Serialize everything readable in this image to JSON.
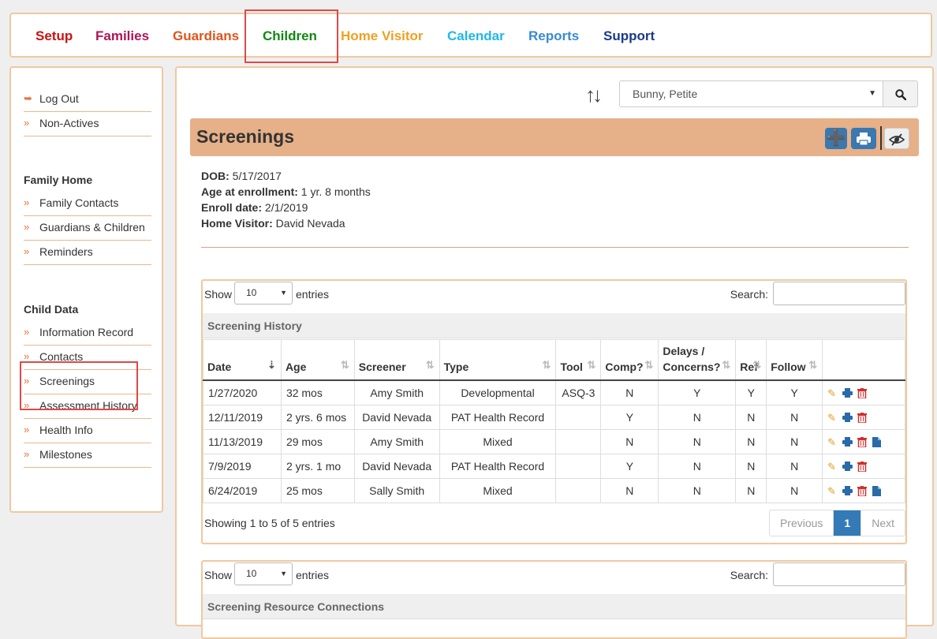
{
  "nav": {
    "items": [
      {
        "label": "Setup",
        "color": "#cc1111"
      },
      {
        "label": "Families",
        "color": "#b0145a"
      },
      {
        "label": "Guardians",
        "color": "#e0541c"
      },
      {
        "label": "Children",
        "color": "#118811"
      },
      {
        "label": "Home Visitor",
        "color": "#f0a020"
      },
      {
        "label": "Calendar",
        "color": "#20b8e8"
      },
      {
        "label": "Reports",
        "color": "#3a8ad0"
      },
      {
        "label": "Support",
        "color": "#1a3a8a"
      }
    ],
    "active": "Children"
  },
  "sidebar": {
    "top_items": [
      {
        "label": "Log Out",
        "icon": "logout-icon"
      },
      {
        "label": "Non-Actives",
        "icon": "chevron-icon"
      }
    ],
    "family_heading": "Family Home",
    "family_items": [
      "Family Contacts",
      "Guardians & Children",
      "Reminders"
    ],
    "child_heading": "Child Data",
    "child_items": [
      "Information Record",
      "Contacts",
      "Screenings",
      "Assessment History",
      "Health Info",
      "Milestones"
    ],
    "active": "Screenings"
  },
  "selector": {
    "value": "Bunny, Petite"
  },
  "page": {
    "title": "Screenings"
  },
  "child_info": {
    "dob_label": "DOB:",
    "dob": "5/17/2017",
    "age_label": "Age at enrollment:",
    "age": "1 yr. 8 months",
    "enroll_label": "Enroll date:",
    "enroll": "2/1/2019",
    "visitor_label": "Home Visitor:",
    "visitor": "David Nevada"
  },
  "history_table": {
    "show_label": "Show",
    "entries_label": "entries",
    "length_value": "10",
    "search_label": "Search:",
    "caption": "Screening History",
    "columns": [
      "Date",
      "Age",
      "Screener",
      "Type",
      "Tool",
      "Comp?",
      "Delays / Concerns?",
      "Ref",
      "Follow",
      ""
    ],
    "rows": [
      {
        "date": "1/27/2020",
        "age": "32 mos",
        "screener": "Amy Smith",
        "type": "Developmental",
        "tool": "ASQ-3",
        "comp": "N",
        "delays": "Y",
        "ref": "Y",
        "follow": "Y",
        "doc": false
      },
      {
        "date": "12/11/2019",
        "age": "2 yrs. 6 mos",
        "screener": "David Nevada",
        "type": "PAT Health Record",
        "tool": "",
        "comp": "Y",
        "delays": "N",
        "ref": "N",
        "follow": "N",
        "doc": false
      },
      {
        "date": "11/13/2019",
        "age": "29 mos",
        "screener": "Amy Smith",
        "type": "Mixed",
        "tool": "",
        "comp": "N",
        "delays": "N",
        "ref": "N",
        "follow": "N",
        "doc": true
      },
      {
        "date": "7/9/2019",
        "age": "2 yrs. 1 mo",
        "screener": "David Nevada",
        "type": "PAT Health Record",
        "tool": "",
        "comp": "Y",
        "delays": "N",
        "ref": "N",
        "follow": "N",
        "doc": false
      },
      {
        "date": "6/24/2019",
        "age": "25 mos",
        "screener": "Sally Smith",
        "type": "Mixed",
        "tool": "",
        "comp": "N",
        "delays": "N",
        "ref": "N",
        "follow": "N",
        "doc": true
      }
    ],
    "info": "Showing 1 to 5 of 5 entries",
    "pagination": {
      "previous": "Previous",
      "page": "1",
      "next": "Next"
    }
  },
  "resource_table": {
    "show_label": "Show",
    "entries_label": "entries",
    "length_value": "10",
    "search_label": "Search:",
    "caption": "Screening Resource Connections"
  }
}
